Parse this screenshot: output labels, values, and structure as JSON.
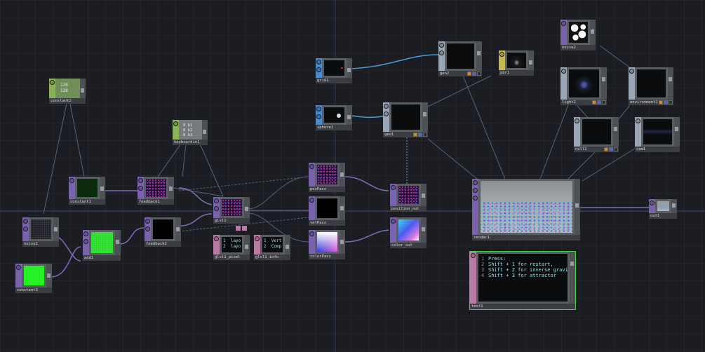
{
  "nodes": {
    "noise2": "noise2",
    "geo2": "geo2",
    "pbr1": "pbr1",
    "grid1": "grid1",
    "light1": "light1",
    "environment1": "environment1",
    "constant2": "constant2",
    "constant2_values": "128\n128",
    "sphere1": "sphere1",
    "geo1": "geo1",
    "null1": "null1",
    "cam1": "cam1",
    "keyboardin1": "keyboardin1",
    "keyboardin1_values": "0 k1\n0 k2\n0 k3",
    "constant1": "constant1",
    "feedback1": "feedback1",
    "posPass": "posPass",
    "position_out": "position_out",
    "render1": "render1",
    "out1": "out1",
    "noise1": "noise1",
    "glsl1": "glsl1",
    "velPass": "velPass",
    "add1": "add1",
    "feedback2": "feedback2",
    "colorPass": "colorPass",
    "color_out": "color_out",
    "constant3": "constant3",
    "glsl1_pixel": "glsl1_pixel",
    "glsl1_pixel_code": "1  layo\n2  layo",
    "glsl1_info": "glsl1_info",
    "glsl1_info_code": "1  Vert\n2  Comp",
    "text1": "text1",
    "text1_lines": "Press:\nShift + 1 for restart,\nShift + 2 for inverse gravi\nShift + 3 for attractor",
    "text1_linenums": "1\n2\n3\n4"
  },
  "colors": {
    "top": "#7a63ad",
    "chop": "#8ab258",
    "sop": "#4b89c8",
    "comp": "#9aa6b5",
    "dat": "#b87ba6",
    "mat": "#c8b848",
    "selected": "#48d148"
  }
}
